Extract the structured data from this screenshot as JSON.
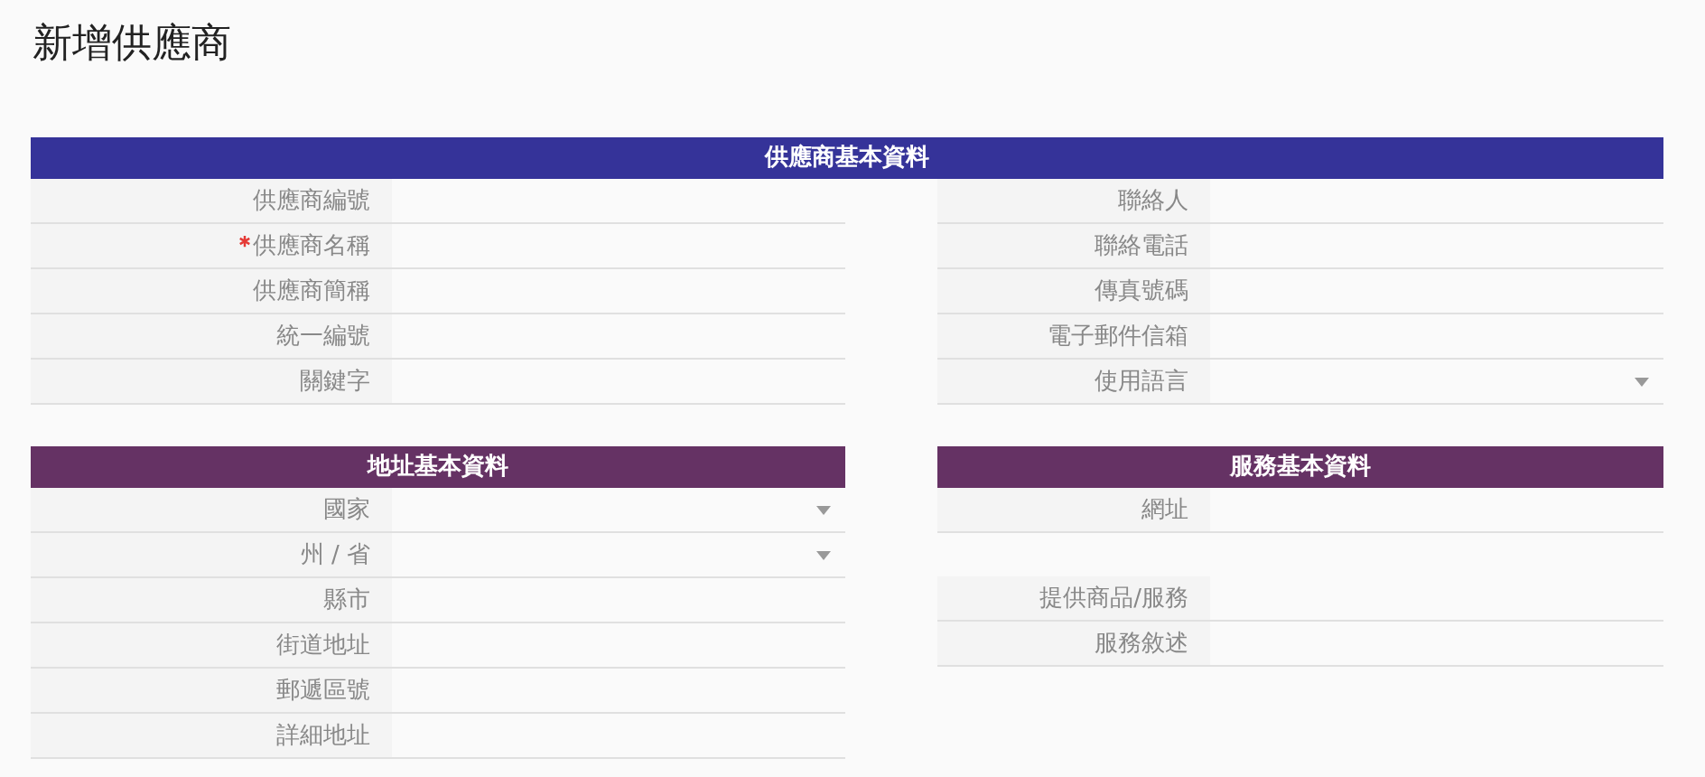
{
  "page_title": "新增供應商",
  "top_section": {
    "title": "供應商基本資料",
    "color": "#353399",
    "columns": [
      [
        {
          "label": "供應商編號",
          "kind": "text",
          "required": false
        },
        {
          "label": "供應商名稱",
          "kind": "text",
          "required": true
        },
        {
          "label": "供應商簡稱",
          "kind": "text",
          "required": false
        },
        {
          "label": "統一編號",
          "kind": "text",
          "required": false
        },
        {
          "label": "關鍵字",
          "kind": "text",
          "required": false
        }
      ],
      [
        {
          "label": "聯絡人",
          "kind": "text",
          "required": false
        },
        {
          "label": "聯絡電話",
          "kind": "text",
          "required": false
        },
        {
          "label": "傳真號碼",
          "kind": "text",
          "required": false
        },
        {
          "label": "電子郵件信箱",
          "kind": "text",
          "required": false
        },
        {
          "label": "使用語言",
          "kind": "select",
          "required": false
        }
      ]
    ]
  },
  "bottom_sections": [
    {
      "title": "地址基本資料",
      "color": "#653264",
      "fields": [
        {
          "label": "國家",
          "kind": "select",
          "required": false,
          "gap_before": false
        },
        {
          "label": "州 / 省",
          "kind": "select",
          "required": false,
          "gap_before": false
        },
        {
          "label": "縣市",
          "kind": "text",
          "required": false,
          "gap_before": false
        },
        {
          "label": "街道地址",
          "kind": "text",
          "required": false,
          "gap_before": false
        },
        {
          "label": "郵遞區號",
          "kind": "text",
          "required": false,
          "gap_before": false
        },
        {
          "label": "詳細地址",
          "kind": "text",
          "required": false,
          "gap_before": false
        }
      ]
    },
    {
      "title": "服務基本資料",
      "color": "#653264",
      "fields": [
        {
          "label": "網址",
          "kind": "text",
          "required": false,
          "gap_before": false
        },
        {
          "label": "提供商品/服務",
          "kind": "text",
          "required": false,
          "gap_before": true
        },
        {
          "label": "服務敘述",
          "kind": "text",
          "required": false,
          "gap_before": false
        }
      ]
    }
  ]
}
